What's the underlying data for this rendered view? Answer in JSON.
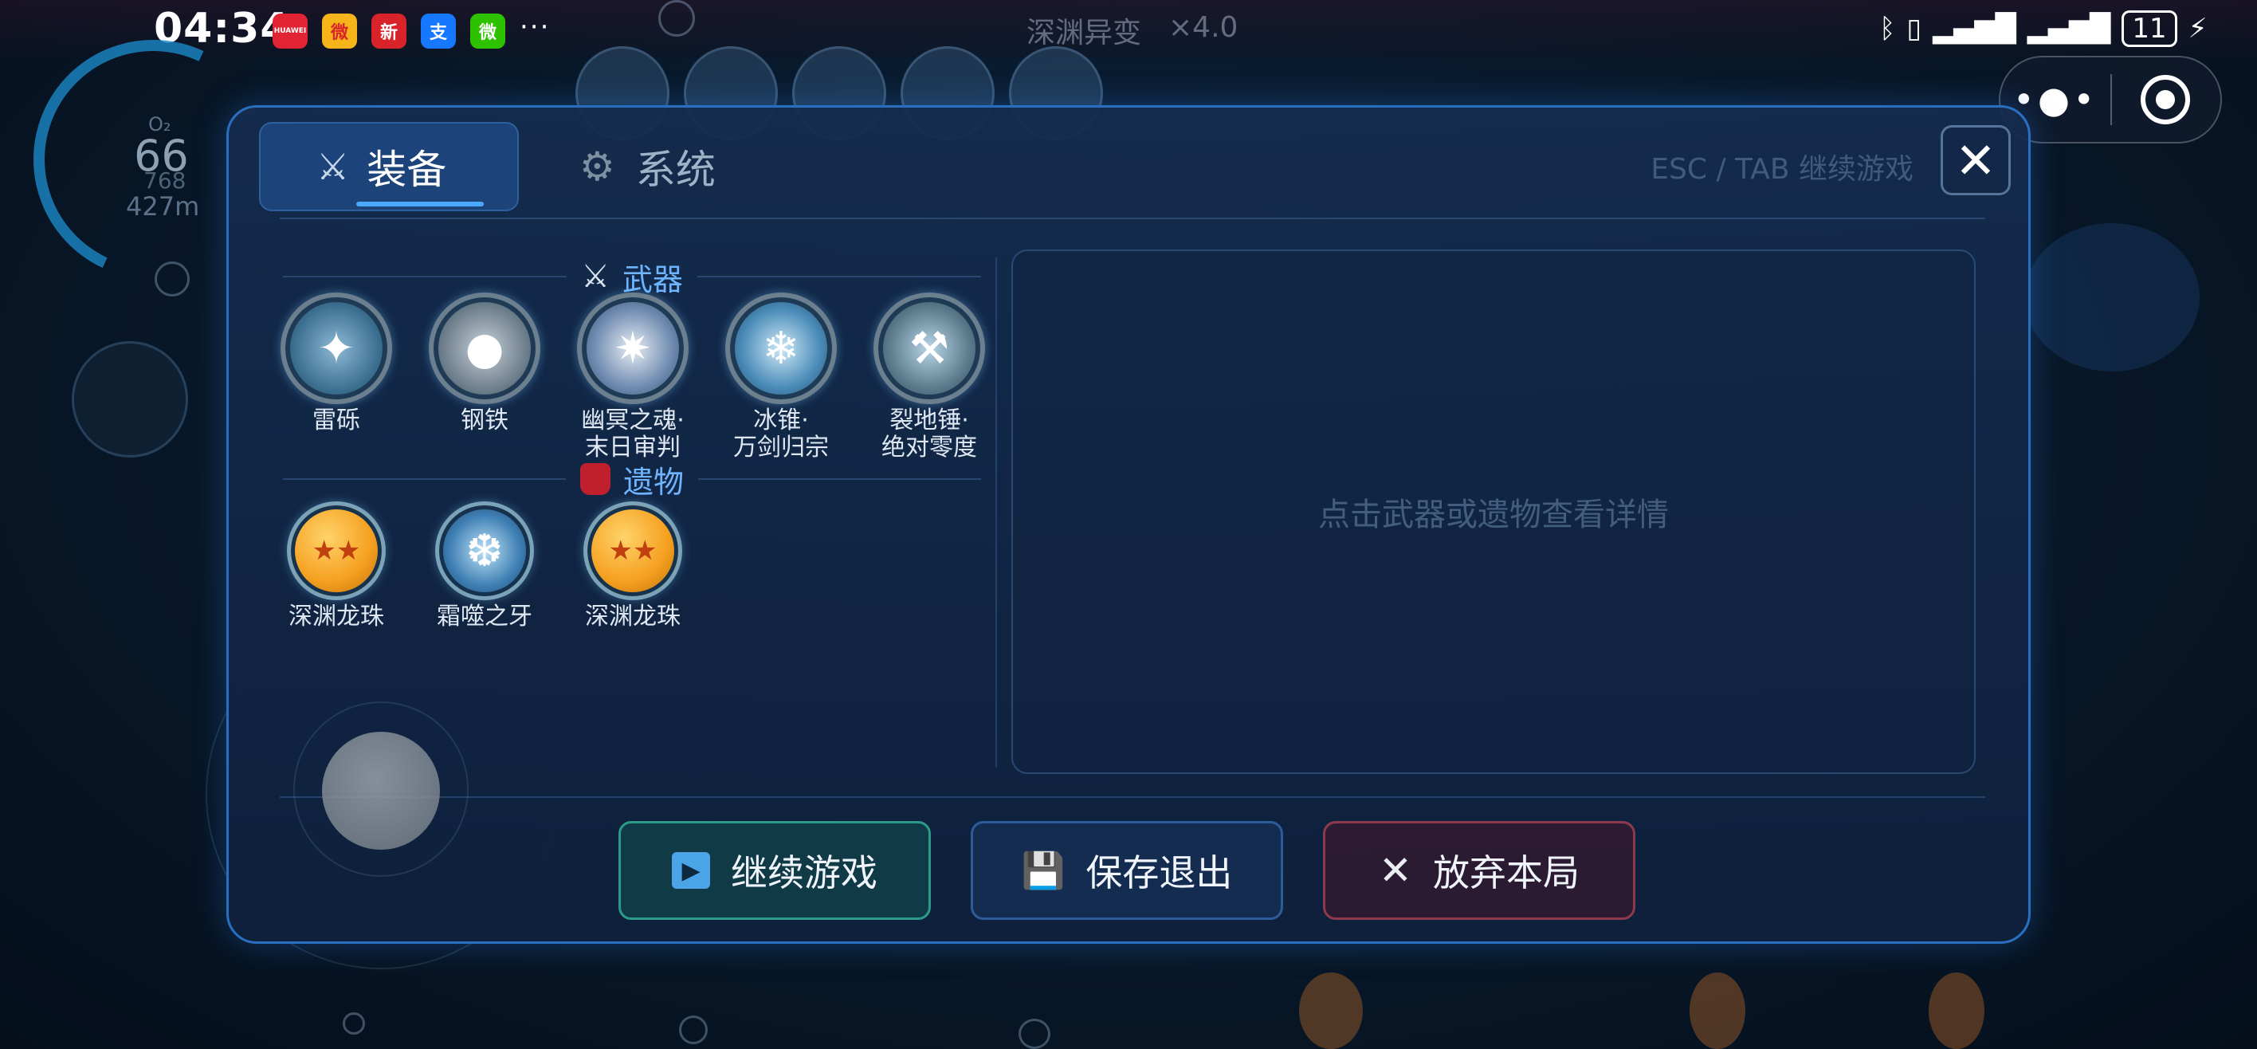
{
  "status_bar": {
    "time": "04:34",
    "apps": [
      {
        "name": "huawei-app-icon",
        "color": "#e02434",
        "glyph": "HUAWEI"
      },
      {
        "name": "weibo-icon",
        "color": "#f5b41a",
        "glyph": "微"
      },
      {
        "name": "news-app-icon",
        "color": "#d8232a",
        "glyph": "新"
      },
      {
        "name": "alipay-icon",
        "color": "#1677ff",
        "glyph": "支"
      },
      {
        "name": "wechat-icon",
        "color": "#2dc100",
        "glyph": "微"
      }
    ],
    "more": "···",
    "battery": "11"
  },
  "game": {
    "title": "深渊异变",
    "speed": "×4.0"
  },
  "hud": {
    "o2_label": "O₂",
    "o2_value": "66",
    "o2_sub": "768",
    "depth": "427m"
  },
  "dialog": {
    "tabs": [
      {
        "label": "装备",
        "icon": "crossed-swords-icon",
        "active": true
      },
      {
        "label": "系统",
        "icon": "gear-icon",
        "active": false
      }
    ],
    "esc_hint": "ESC / TAB 继续游戏",
    "close_label": "✕",
    "weapons_heading": "武器",
    "weapons": [
      {
        "name_line1": "雷砾",
        "name_line2": "",
        "color": "#3a6e8f",
        "glyph": "✦"
      },
      {
        "name_line1": "钢铁",
        "name_line2": "",
        "color": "#6b7c8a",
        "glyph": "●"
      },
      {
        "name_line1": "幽冥之魂·",
        "name_line2": "末日审判",
        "color": "#6f8bb0",
        "glyph": "✷"
      },
      {
        "name_line1": "冰锥·",
        "name_line2": "万剑归宗",
        "color": "#4a8bb8",
        "glyph": "❄"
      },
      {
        "name_line1": "裂地锤·",
        "name_line2": "绝对零度",
        "color": "#5d7c8e",
        "glyph": "⚒"
      }
    ],
    "relics_heading": "遗物",
    "relics": [
      {
        "name": "深渊龙珠",
        "color": "#f5a020",
        "glyph": "★"
      },
      {
        "name": "霜噬之牙",
        "color": "#3f7fb4",
        "glyph": "❆"
      },
      {
        "name": "深渊龙珠",
        "color": "#f5a020",
        "glyph": "★"
      }
    ],
    "detail_placeholder": "点击武器或遗物查看详情",
    "buttons": {
      "continue": {
        "label": "继续游戏",
        "icon": "play-icon"
      },
      "save_exit": {
        "label": "保存退出",
        "icon": "floppy-disk-icon"
      },
      "abandon": {
        "label": "放弃本局",
        "icon": "close-icon"
      }
    }
  },
  "colors": {
    "accent": "#4aa8ff",
    "heading": "#6fb4ff",
    "dialog_border": "#2a6fbf"
  }
}
